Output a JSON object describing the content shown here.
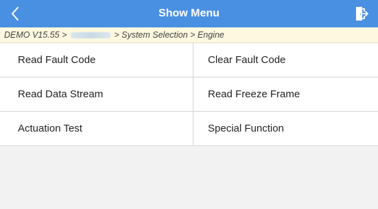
{
  "header": {
    "title": "Show Menu",
    "back_icon": "chevron-left-icon",
    "exit_icon": "exit-door-icon",
    "bg_color": "#4a90e2"
  },
  "breadcrumb": {
    "prefix": "DEMO V15.55 >",
    "suffix": "> System Selection > Engine",
    "bg_color": "#fdf8df"
  },
  "menu": {
    "items": [
      {
        "label": "Read Fault Code"
      },
      {
        "label": "Clear Fault Code"
      },
      {
        "label": "Read Data Stream"
      },
      {
        "label": "Read Freeze Frame"
      },
      {
        "label": "Actuation Test"
      },
      {
        "label": "Special Function"
      }
    ]
  }
}
